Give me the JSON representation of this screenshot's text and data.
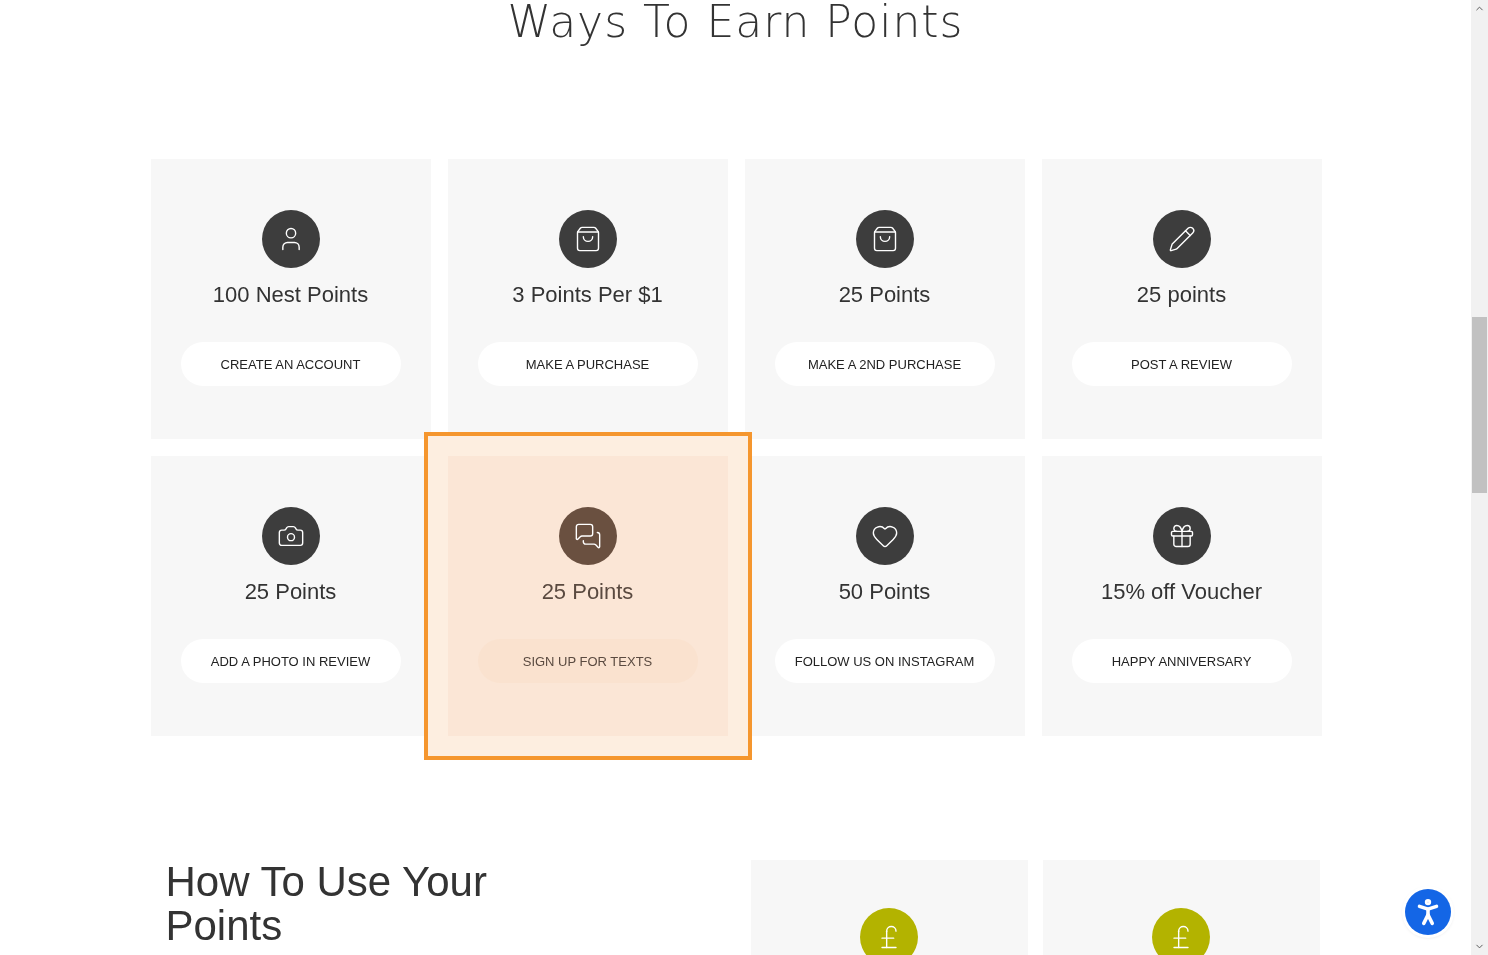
{
  "earn_section": {
    "title": "Ways To Earn Points",
    "cards": [
      {
        "kind": "user",
        "points": "100 Nest Points",
        "action": "CREATE AN ACCOUNT",
        "highlighted": false
      },
      {
        "kind": "bag",
        "points": "3 Points Per $1",
        "action": "MAKE A PURCHASE",
        "highlighted": false
      },
      {
        "kind": "bag",
        "points": "25 Points",
        "action": "MAKE A 2ND PURCHASE",
        "highlighted": false
      },
      {
        "kind": "pencil",
        "points": "25 points",
        "action": "POST A REVIEW",
        "highlighted": false
      },
      {
        "kind": "camera",
        "points": "25 Points",
        "action": "ADD A PHOTO IN REVIEW",
        "highlighted": false
      },
      {
        "kind": "chat",
        "points": "25 Points",
        "action": "SIGN UP FOR TEXTS",
        "highlighted": true
      },
      {
        "kind": "heart",
        "points": "50 Points",
        "action": "FOLLOW US ON INSTAGRAM",
        "highlighted": false
      },
      {
        "kind": "gift",
        "points": "15% off Voucher",
        "action": "HAPPY ANNIVERSARY",
        "highlighted": false
      }
    ]
  },
  "use_section": {
    "title": "How To Use Your Points",
    "cards": [
      {
        "kind": "pound"
      },
      {
        "kind": "pound"
      }
    ]
  }
}
